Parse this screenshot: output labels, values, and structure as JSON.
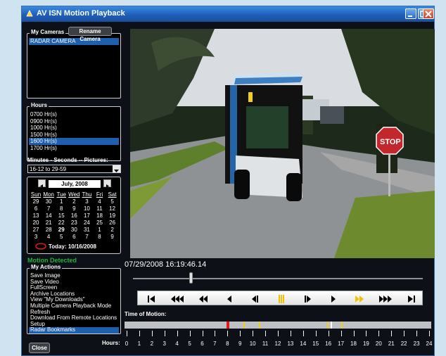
{
  "window": {
    "title": "AV ISN Motion Playback"
  },
  "cameras": {
    "legend": "My Cameras",
    "rename_label": "Rename Camera",
    "items": [
      "RADAR CAMERA"
    ]
  },
  "hours_panel": {
    "legend": "Hours",
    "items": [
      "0700 Hr(s)",
      "0900 Hr(s)",
      "1000 Hr(s)",
      "1500 Hr(s)",
      "1600 Hr(s)",
      "1700 Hr(s)"
    ],
    "selected_index": 4
  },
  "minutes": {
    "label": "Minutes - Seconds -- Pictures:",
    "value": "16-12 to 29-59"
  },
  "calendar": {
    "month": "July, 2008",
    "weekdays": [
      "Sun",
      "Mon",
      "Tue",
      "Wed",
      "Thu",
      "Fri",
      "Sat"
    ],
    "weeks": [
      [
        "29",
        "30",
        "1",
        "2",
        "3",
        "4",
        "5"
      ],
      [
        "6",
        "7",
        "8",
        "9",
        "10",
        "11",
        "12"
      ],
      [
        "13",
        "14",
        "15",
        "16",
        "17",
        "18",
        "19"
      ],
      [
        "20",
        "21",
        "22",
        "23",
        "24",
        "25",
        "26"
      ],
      [
        "27",
        "28",
        "29",
        "30",
        "31",
        "1",
        "2"
      ],
      [
        "3",
        "4",
        "5",
        "6",
        "7",
        "8",
        "9"
      ]
    ],
    "today_text": "Today: 10/16/2008"
  },
  "motion_detected": "Motion Detected",
  "actions": {
    "legend": "My Actions",
    "items": [
      "Save Image",
      "Save Video",
      "FullScreen",
      "Archive Locations",
      "View \"My Downloads\"",
      "Multiple Camera Playback Mode",
      "Refresh",
      "Download From Remote Locations",
      "Setup",
      "Radar Bookmarks"
    ],
    "selected_index": 9
  },
  "playback": {
    "timestamp": "07/29/2008  16:19:46.14",
    "position_fraction": 0.2
  },
  "time_of_motion": {
    "label": "Time of Motion:",
    "hours_label": "Hours:",
    "hours": [
      "0",
      "1",
      "2",
      "3",
      "4",
      "5",
      "6",
      "7",
      "8",
      "9",
      "10",
      "11",
      "12",
      "13",
      "14",
      "15",
      "16",
      "17",
      "18",
      "19",
      "20",
      "21",
      "22",
      "23",
      "24"
    ],
    "events": [
      {
        "hour": 7.95,
        "color": "#e01818"
      },
      {
        "hour": 9.25,
        "color": "#e8d21a"
      },
      {
        "hour": 10.5,
        "color": "#e8d21a"
      },
      {
        "hour": 15.9,
        "color": "#e8d21a"
      },
      {
        "hour": 16.2,
        "color": "#ffffff"
      },
      {
        "hour": 17.05,
        "color": "#e8d21a"
      }
    ]
  },
  "controls": [
    "first-icon",
    "fast-rewind-icon",
    "rewind-icon",
    "step-back-icon",
    "frame-back-icon",
    "pause-icon",
    "frame-forward-icon",
    "play-icon",
    "fast-forward-icon",
    "faster-forward-icon",
    "last-icon"
  ],
  "close_label": "Close",
  "colors": {
    "title_bar": "#1f5fb8",
    "selection": "#1e5fb0",
    "motion_green": "#1fb33d",
    "accent_yellow": "#f2c200"
  }
}
